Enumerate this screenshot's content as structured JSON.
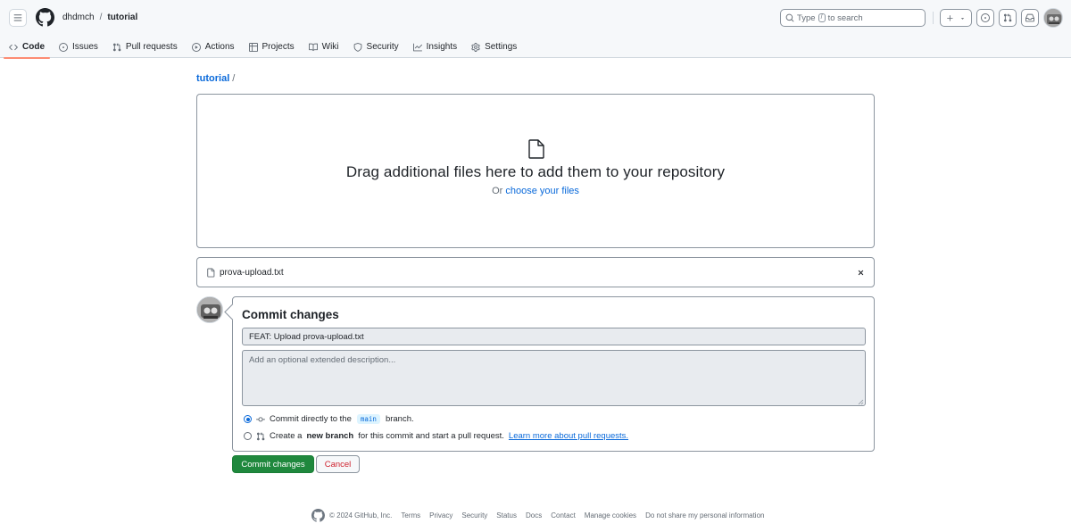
{
  "header": {
    "owner": "dhdmch",
    "separator": "/",
    "repo": "tutorial",
    "search_prefix": "Type",
    "search_key": "/",
    "search_suffix": "to search"
  },
  "repo_nav": [
    {
      "label": "Code",
      "icon": "code-icon",
      "selected": true
    },
    {
      "label": "Issues",
      "icon": "issue-icon"
    },
    {
      "label": "Pull requests",
      "icon": "pull-request-icon"
    },
    {
      "label": "Actions",
      "icon": "play-icon"
    },
    {
      "label": "Projects",
      "icon": "table-icon"
    },
    {
      "label": "Wiki",
      "icon": "book-icon"
    },
    {
      "label": "Security",
      "icon": "shield-icon"
    },
    {
      "label": "Insights",
      "icon": "graph-icon"
    },
    {
      "label": "Settings",
      "icon": "gear-icon"
    }
  ],
  "path": {
    "repo_link": "tutorial",
    "slash": "/"
  },
  "dropzone": {
    "title": "Drag additional files here to add them to your repository",
    "or_text": "Or",
    "choose_link": "choose your files"
  },
  "file": {
    "name": "prova-upload.txt"
  },
  "commit": {
    "heading": "Commit changes",
    "message_value": "FEAT: Upload prova-upload.txt",
    "description_placeholder": "Add an optional extended description...",
    "option_direct_prefix": "Commit directly to the",
    "option_direct_branch": "main",
    "option_direct_suffix": "branch.",
    "option_new_prefix": "Create a",
    "option_new_bold": "new branch",
    "option_new_suffix": "for this commit and start a pull request.",
    "option_new_link": "Learn more about pull requests.",
    "commit_button": "Commit changes",
    "cancel_button": "Cancel"
  },
  "footer": {
    "copyright": "© 2024 GitHub, Inc.",
    "links": [
      "Terms",
      "Privacy",
      "Security",
      "Status",
      "Docs",
      "Contact",
      "Manage cookies",
      "Do not share my personal information"
    ]
  },
  "colors": {
    "accent": "#0969da",
    "primary_button": "#1f883d",
    "danger_text": "#cf222e",
    "nav_underline": "#fd8c73"
  }
}
